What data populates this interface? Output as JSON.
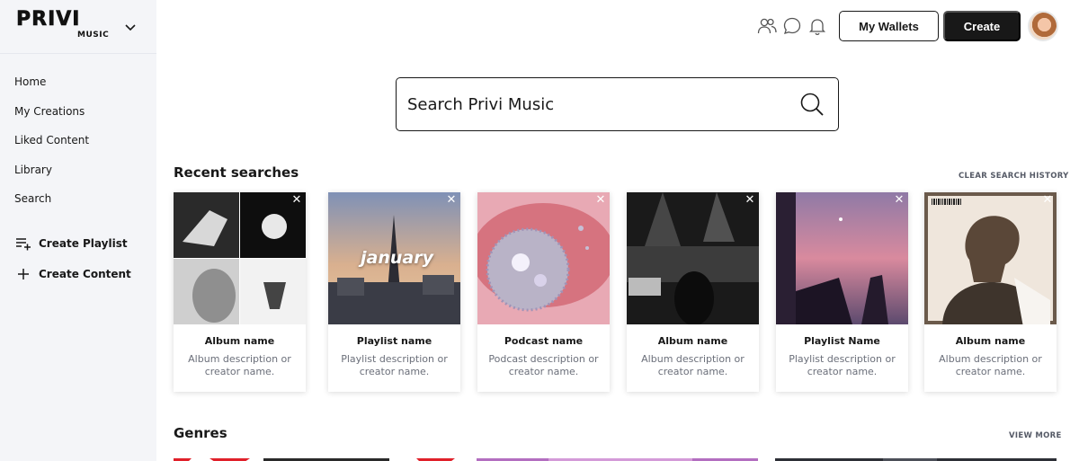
{
  "app": {
    "logo_text": "PRIVI",
    "logo_sub": "MUSIC"
  },
  "sidebar": {
    "items": [
      {
        "label": "Home"
      },
      {
        "label": "My Creations"
      },
      {
        "label": "Liked Content"
      },
      {
        "label": "Library"
      },
      {
        "label": "Search"
      }
    ],
    "create_playlist": "Create Playlist",
    "create_content": "Create Content"
  },
  "header": {
    "wallets_label": "My Wallets",
    "create_label": "Create",
    "icons": [
      "people-icon",
      "chat-bubble-icon",
      "bell-icon"
    ]
  },
  "search": {
    "placeholder": "Search Privi Music"
  },
  "recent": {
    "title": "Recent searches",
    "clear_label": "CLEAR SEARCH HISTORY",
    "cards": [
      {
        "name": "Album name",
        "desc": "Album description or creator name."
      },
      {
        "name": "Playlist name",
        "desc": "Playlist description or creator name.",
        "overlay": "january"
      },
      {
        "name": "Podcast name",
        "desc": "Podcast description or creator name."
      },
      {
        "name": "Album name",
        "desc": "Album description or creator name."
      },
      {
        "name": "Playlist Name",
        "desc": "Playlist description or creator name."
      },
      {
        "name": "Album name",
        "desc": "Album description or creator name."
      }
    ]
  },
  "genres": {
    "title": "Genres",
    "view_more_label": "VIEW MORE"
  }
}
